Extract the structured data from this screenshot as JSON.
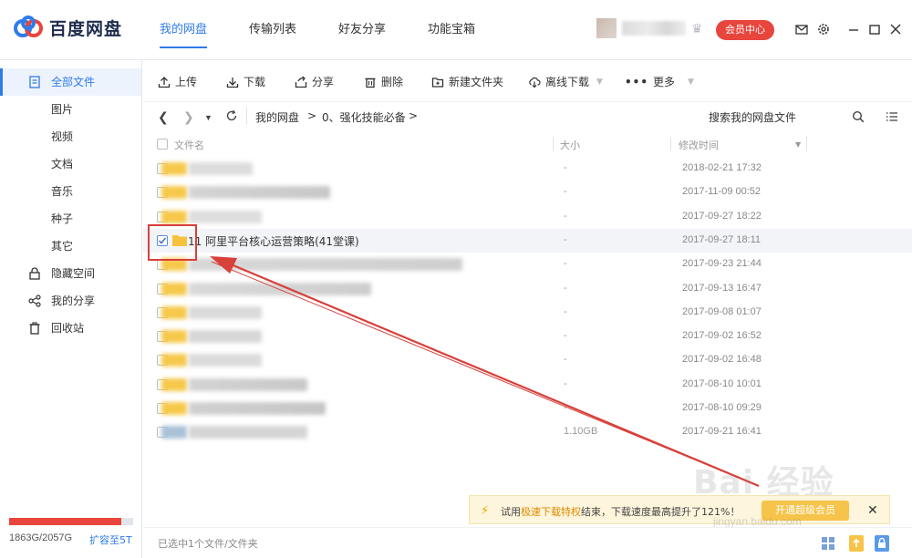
{
  "app": {
    "logo_text": "百度网盘",
    "nav_tabs": [
      {
        "label": "我的网盘",
        "active": true
      },
      {
        "label": "传输列表",
        "active": false
      },
      {
        "label": "好友分享",
        "active": false
      },
      {
        "label": "功能宝箱",
        "active": false
      }
    ],
    "vip_label": "会员中心",
    "icons": [
      "mail-icon",
      "gear-icon",
      "minimize-icon",
      "maximize-icon",
      "close-icon"
    ],
    "accent_color": "#2f7be8",
    "danger_color": "#e8453c"
  },
  "sidebar": {
    "items": [
      {
        "label": "全部文件",
        "icon": "file-icon",
        "active": true
      },
      {
        "label": "图片",
        "icon": "",
        "active": false
      },
      {
        "label": "视频",
        "icon": "",
        "active": false
      },
      {
        "label": "文档",
        "icon": "",
        "active": false
      },
      {
        "label": "音乐",
        "icon": "",
        "active": false
      },
      {
        "label": "种子",
        "icon": "",
        "active": false
      },
      {
        "label": "其它",
        "icon": "",
        "active": false
      },
      {
        "label": "隐藏空间",
        "icon": "lock-icon",
        "active": false
      },
      {
        "label": "我的分享",
        "icon": "share-icon",
        "active": false
      },
      {
        "label": "回收站",
        "icon": "trash-icon",
        "active": false
      }
    ],
    "storage_text": "1863G/2057G",
    "storage_used_fraction": 0.906,
    "expand_label": "扩容至5T"
  },
  "toolbar": {
    "upload": "上传",
    "download": "下载",
    "share": "分享",
    "delete": "删除",
    "new_folder": "新建文件夹",
    "offline_download": "离线下载",
    "more": "更多"
  },
  "pathbar": {
    "crumbs": [
      "我的网盘",
      "0、强化技能必备"
    ],
    "separator": ">",
    "search_label": "搜索我的网盘文件"
  },
  "list": {
    "columns": {
      "name": "文件名",
      "size": "大小",
      "modified": "修改时间"
    },
    "rows": [
      {
        "name": "",
        "size": "-",
        "date": "2018-02-21 17:32",
        "selected": false
      },
      {
        "name": "",
        "size": "-",
        "date": "2017-11-09 00:52",
        "selected": false
      },
      {
        "name": "",
        "size": "-",
        "date": "2017-09-27 18:22",
        "selected": false
      },
      {
        "name": "11 阿里平台核心运营策略(41堂课)",
        "size": "-",
        "date": "2017-09-27 18:11",
        "selected": true
      },
      {
        "name": "",
        "size": "-",
        "date": "2017-09-23 21:44",
        "selected": false
      },
      {
        "name": "",
        "size": "-",
        "date": "2017-09-13 16:47",
        "selected": false
      },
      {
        "name": "",
        "size": "-",
        "date": "2017-09-08 01:07",
        "selected": false
      },
      {
        "name": "",
        "size": "-",
        "date": "2017-09-02 16:52",
        "selected": false
      },
      {
        "name": "",
        "size": "-",
        "date": "2017-09-02 16:48",
        "selected": false
      },
      {
        "name": "",
        "size": "-",
        "date": "2017-08-10 10:01",
        "selected": false
      },
      {
        "name": "",
        "size": "-",
        "date": "2017-08-10 09:29",
        "selected": false
      },
      {
        "name": "",
        "size": "1.10GB",
        "date": "2017-09-21 16:41",
        "selected": false
      }
    ]
  },
  "notice": {
    "prefix": "试用",
    "highlight": "极速下载特权",
    "suffix": "结束，下载速度最高提升了121%！",
    "button": "开通超级会员"
  },
  "status": {
    "selection_text": "已选中1个文件/文件夹"
  },
  "watermark": {
    "text": "Bai 经验",
    "sub": "jingyan.baidu.com"
  }
}
